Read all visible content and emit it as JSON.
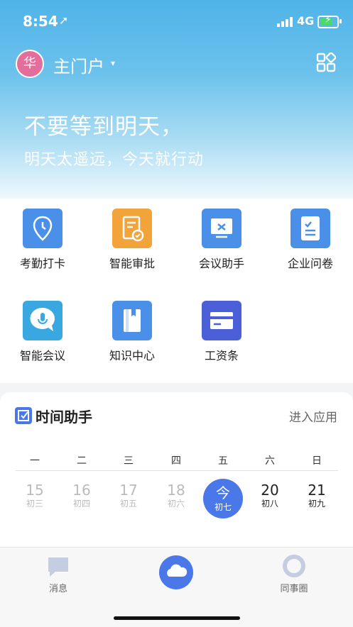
{
  "status_bar": {
    "time": "8:54",
    "location_glyph": "➚",
    "network": "4G",
    "battery_level": 0.7
  },
  "header": {
    "avatar_text": "华",
    "portal_name": "主门户",
    "caret": "▾"
  },
  "hero": {
    "line1": "不要等到明天，",
    "line2": "明天太遥远，今天就行动"
  },
  "apps": [
    {
      "label": "考勤打卡",
      "icon": "location-pin-icon",
      "color": "#4a8fe8"
    },
    {
      "label": "智能审批",
      "icon": "approval-document-icon",
      "color": "#f2a33a"
    },
    {
      "label": "会议助手",
      "icon": "presentation-board-icon",
      "color": "#4a8fe8"
    },
    {
      "label": "企业问卷",
      "icon": "questionnaire-document-icon",
      "color": "#4a8fe8"
    },
    {
      "label": "智能会议",
      "icon": "microphone-bubble-icon",
      "color": "#3aa8e0"
    },
    {
      "label": "知识中心",
      "icon": "book-icon",
      "color": "#4a8fe8"
    },
    {
      "label": "工资条",
      "icon": "payslip-card-icon",
      "color": "#4a5fd8"
    }
  ],
  "time_helper": {
    "title": "时间助手",
    "enter_label": "进入应用",
    "weekdays": [
      "一",
      "二",
      "三",
      "四",
      "五",
      "六",
      "日"
    ],
    "days": [
      {
        "num": "15",
        "lunar": "初三",
        "state": "past"
      },
      {
        "num": "16",
        "lunar": "初四",
        "state": "past"
      },
      {
        "num": "17",
        "lunar": "初五",
        "state": "past"
      },
      {
        "num": "18",
        "lunar": "初六",
        "state": "past"
      },
      {
        "num": "今",
        "lunar": "初七",
        "state": "today"
      },
      {
        "num": "20",
        "lunar": "初八",
        "state": "future"
      },
      {
        "num": "21",
        "lunar": "初九",
        "state": "future"
      }
    ]
  },
  "tabbar": {
    "messages": "消息",
    "colleagues": "同事圈"
  },
  "colors": {
    "accent": "#4a78e8",
    "hero_top": "#4fb3e8"
  }
}
